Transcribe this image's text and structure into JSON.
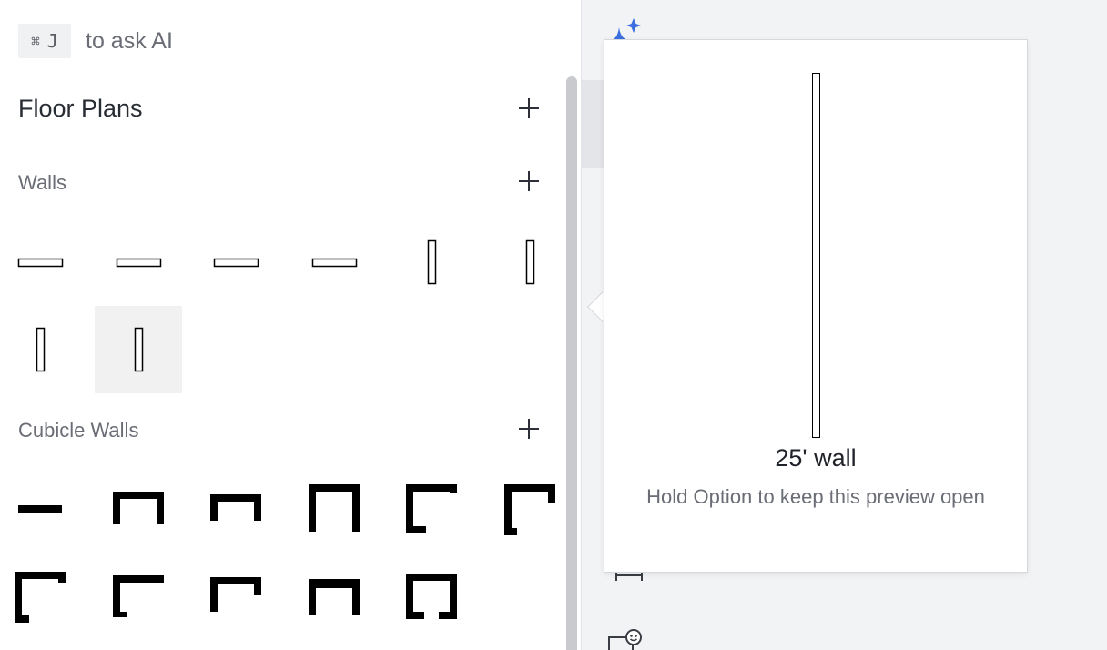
{
  "ai_hint": {
    "key_cmd": "⌘",
    "key_letter": "J",
    "text": "to ask AI"
  },
  "library": {
    "title": "Floor Plans",
    "sections": [
      {
        "title": "Walls",
        "shape_count": 8,
        "selected_index": 7
      },
      {
        "title": "Cubicle Walls",
        "shape_count": 11
      }
    ]
  },
  "icons": {
    "add": "plus-icon",
    "ai": "sparkle-icon",
    "dimension": "dimension-tool-icon",
    "sticker": "face-sticker-icon"
  },
  "preview": {
    "name": "25' wall",
    "hint": "Hold Option to keep this preview open"
  },
  "colors": {
    "accent": "#3b6fe0",
    "panel_bg": "#ffffff",
    "canvas_bg": "#f2f3f5",
    "selected_tile": "#f1f1f2"
  }
}
